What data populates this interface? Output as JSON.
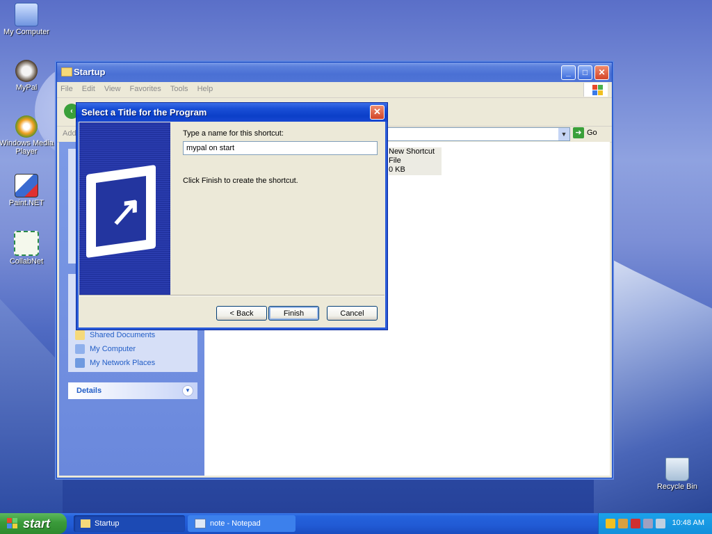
{
  "desktop": {
    "icons": [
      {
        "label": "My Computer"
      },
      {
        "label": "MyPal"
      },
      {
        "label": "Windows Media Player"
      },
      {
        "label": "Paint.NET"
      },
      {
        "label": "CollabNet"
      },
      {
        "label": "Recycle Bin"
      }
    ]
  },
  "explorer": {
    "title": "Startup",
    "menu": [
      "File",
      "Edit",
      "View",
      "Favorites",
      "Tools",
      "Help"
    ],
    "address_label": "Add",
    "go_label": "Go",
    "other_places": [
      "Shared Documents",
      "My Computer",
      "My Network Places"
    ],
    "details_header": "Details",
    "file": {
      "name": "New Shortcut",
      "type": "File",
      "size": "0 KB"
    }
  },
  "dialog": {
    "title": "Select a Title for the Program",
    "prompt": "Type a name for this shortcut:",
    "input_value": "mypal on start",
    "hint": "Click Finish to create the shortcut.",
    "back_label": "< Back",
    "finish_label": "Finish",
    "cancel_label": "Cancel"
  },
  "taskbar": {
    "start_label": "start",
    "tasks": [
      {
        "label": "Startup"
      },
      {
        "label": "note - Notepad"
      }
    ],
    "clock": "10:48 AM"
  },
  "colors": {
    "xp_blue": "#0b3fc8",
    "start_green": "#3a9a3a",
    "link_blue": "#215dc6"
  }
}
